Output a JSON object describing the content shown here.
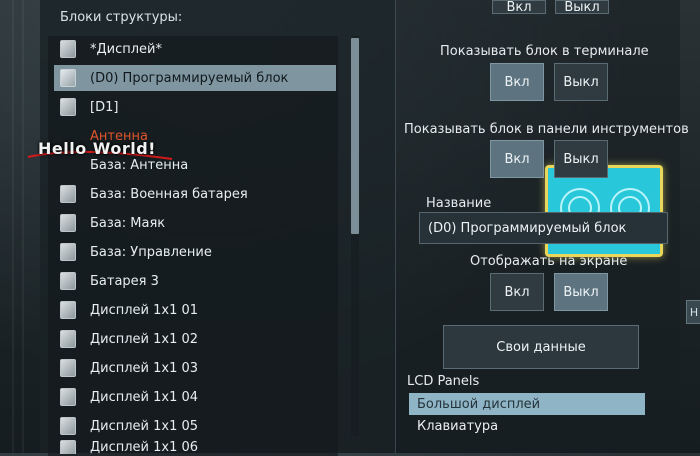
{
  "left": {
    "section_title": "Блоки структуры:",
    "items": [
      {
        "label": "*Дисплей*",
        "icon": "lcd-block-icon"
      },
      {
        "label": "(D0) Программируемый блок",
        "icon": "programmable-block-icon",
        "selected": true
      },
      {
        "label": "[D1]",
        "icon": "lcd-block-icon"
      },
      {
        "label": "Антенна",
        "icon": "antenna-icon",
        "warning": true
      },
      {
        "label": "База: Антенна",
        "icon": "antenna-icon"
      },
      {
        "label": "База: Военная батарея",
        "icon": "battery-icon"
      },
      {
        "label": "База: Маяк",
        "icon": "beacon-icon"
      },
      {
        "label": "База: Управление",
        "icon": "control-seat-icon"
      },
      {
        "label": "Батарея 3",
        "icon": "battery-icon"
      },
      {
        "label": "Дисплей 1x1 01",
        "icon": "lcd-block-icon"
      },
      {
        "label": "Дисплей 1x1 02",
        "icon": "lcd-block-icon"
      },
      {
        "label": "Дисплей 1x1 03",
        "icon": "lcd-block-icon"
      },
      {
        "label": "Дисплей 1x1 04",
        "icon": "lcd-block-icon"
      },
      {
        "label": "Дисплей 1x1 05",
        "icon": "lcd-block-icon"
      },
      {
        "label": "Дисплей 1x1 06",
        "icon": "lcd-block-icon"
      }
    ]
  },
  "overlay": {
    "hello_text": "Hello World!"
  },
  "right": {
    "top_buttons": {
      "on": "Вкл",
      "off": "Выкл"
    },
    "show_in_terminal": {
      "label": "Показывать блок в терминале",
      "on": "Вкл",
      "off": "Выкл",
      "active": "on"
    },
    "show_in_toolbar": {
      "label": "Показывать блок в панели инструментов",
      "on": "Вкл",
      "off": "Выкл",
      "active": "on"
    },
    "name": {
      "label": "Название",
      "value": "(D0) Программируемый блок"
    },
    "show_on_screen": {
      "label": "Отображать на экране",
      "on": "Вкл",
      "off": "Выкл",
      "active": "off"
    },
    "custom_data_button": "Свои данные",
    "lcd": {
      "title": "LCD Panels",
      "items": [
        "Большой дисплей",
        "Клавиатура"
      ],
      "selected_index": 0
    },
    "edge_tab": "H"
  },
  "colors": {
    "selected_row": "#7f96a1",
    "warning_text": "#e0552c",
    "lcd_selected": "#8fb4c6",
    "hello_underline": "#d21a1a"
  }
}
